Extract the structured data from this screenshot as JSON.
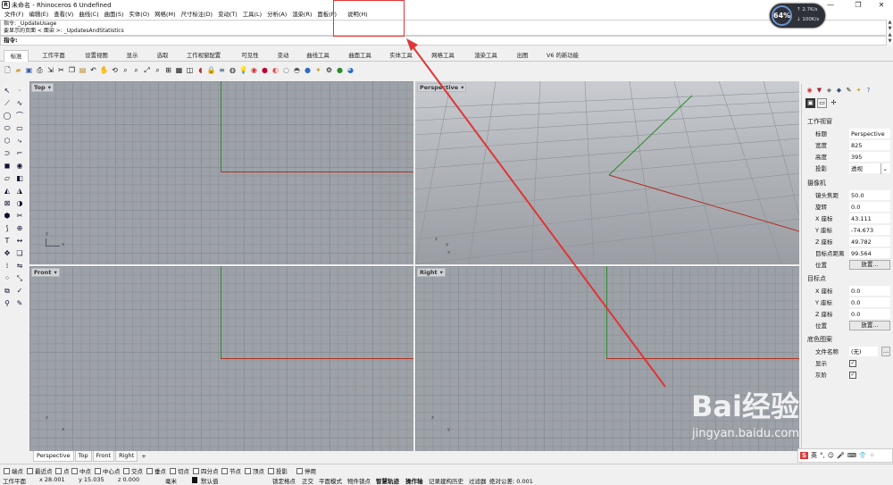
{
  "window": {
    "title": "未命名 - Rhinoceros 6 Undefined",
    "controls": [
      "—",
      "❐",
      "✕"
    ]
  },
  "menu": [
    "文件(F)",
    "编辑(E)",
    "查看(V)",
    "曲线(C)",
    "曲面(S)",
    "实体(O)",
    "网格(M)",
    "尺寸标注(D)",
    "变动(T)",
    "工具(L)",
    "分析(A)",
    "渲染(R)",
    "面板(P)",
    "说明(H)"
  ],
  "command": {
    "history": [
      "指令: _UpdateUsage",
      "要显示的页面 < 面染 >: _UpdatesAndStatistics"
    ],
    "prompt": "指令:"
  },
  "tabs": [
    {
      "label": "标准",
      "active": true
    },
    {
      "label": "工作平面"
    },
    {
      "label": "设置视图"
    },
    {
      "label": "显示"
    },
    {
      "label": "选取"
    },
    {
      "label": "工作视窗配置"
    },
    {
      "label": "可见性"
    },
    {
      "label": "变动"
    },
    {
      "label": "曲线工具"
    },
    {
      "label": "曲面工具"
    },
    {
      "label": "实体工具"
    },
    {
      "label": "网格工具"
    },
    {
      "label": "渲染工具"
    },
    {
      "label": "出图"
    },
    {
      "label": "V6 的新功能"
    }
  ],
  "toolbar_icons": [
    "new-file-icon",
    "open-file-icon",
    "save-icon",
    "print-icon",
    "import-icon",
    "cut-icon",
    "copy-icon",
    "paste-icon",
    "undo-icon",
    "pan-icon",
    "rotate-view-icon",
    "zoom-icon",
    "zoom-window-icon",
    "zoom-extents-icon",
    "zoom-selected-icon",
    "four-views-icon",
    "cplane-icon",
    "set-view-icon",
    "hide-icon",
    "lock-icon",
    "layer-icon",
    "properties-icon",
    "light-icon",
    "render-icon",
    "material-icon",
    "shade-icon",
    "ghosted-icon",
    "xray-icon",
    "rendered-icon",
    "bulb-icon",
    "options-icon",
    "help-icon",
    "extras-icon"
  ],
  "viewports": {
    "top": {
      "label": "Top"
    },
    "perspective": {
      "label": "Perspective"
    },
    "front": {
      "label": "Front"
    },
    "right": {
      "label": "Right"
    },
    "axis_x": "x",
    "axis_y": "y",
    "axis_z": "z"
  },
  "viewport_tabs": [
    {
      "label": "Perspective",
      "active": true
    },
    {
      "label": "Top"
    },
    {
      "label": "Front"
    },
    {
      "label": "Right"
    },
    {
      "label": "+"
    }
  ],
  "panel": {
    "section_viewport": "工作视窗",
    "title_label": "标题",
    "title_value": "Perspective",
    "width_label": "宽度",
    "width_value": "825",
    "height_label": "高度",
    "height_value": "395",
    "projection_label": "投影",
    "projection_value": "透视",
    "section_camera": "摄像机",
    "lens_label": "镜头焦距",
    "lens_value": "50.0",
    "rotation_label": "旋转",
    "rotation_value": "0.0",
    "camx_label": "X 座标",
    "camx_value": "43.111",
    "camy_label": "Y 座标",
    "camy_value": "-74.673",
    "camz_label": "Z 座标",
    "camz_value": "49.782",
    "dist_label": "目标点距离",
    "dist_value": "99.564",
    "cam_pos_label": "位置",
    "cam_pos_btn": "放置...",
    "section_target": "目标点",
    "tx_label": "X 座标",
    "tx_value": "0.0",
    "ty_label": "Y 座标",
    "ty_value": "0.0",
    "tz_label": "Z 座标",
    "tz_value": "0.0",
    "t_pos_label": "位置",
    "t_pos_btn": "放置...",
    "section_wallpaper": "底色图案",
    "file_label": "文件名称",
    "file_value": "(无)",
    "show_label": "显示",
    "gray_label": "灰阶"
  },
  "osnaps": [
    "端点",
    "最近点",
    "点",
    "中点",
    "中心点",
    "交点",
    "垂点",
    "切点",
    "四分点",
    "节点",
    "顶点",
    "投影",
    "停用"
  ],
  "status": {
    "cplane": "工作平面",
    "x": "x 28.001",
    "y": "y 15.035",
    "z": "z 0.000",
    "unit": "毫米",
    "layer": "默认值",
    "items": [
      "锁定格点",
      "正交",
      "平面模式",
      "物件锁点",
      "智慧轨迹",
      "操作轴",
      "记录建构历史",
      "过滤器",
      "绝对公差: 0.001"
    ]
  },
  "perf": {
    "percent": "64%",
    "up": "2.7K/s",
    "down": "100K/s"
  },
  "watermark": {
    "brand": "Bai经验",
    "url": "jingyan.baidu.com"
  },
  "ime": {
    "s": "S",
    "lang": "英"
  },
  "colors": {
    "x_axis": "#b03020",
    "y_axis": "#2a8a2a",
    "annotation": "#e03535",
    "viewport_bg": "#9da1a8"
  }
}
